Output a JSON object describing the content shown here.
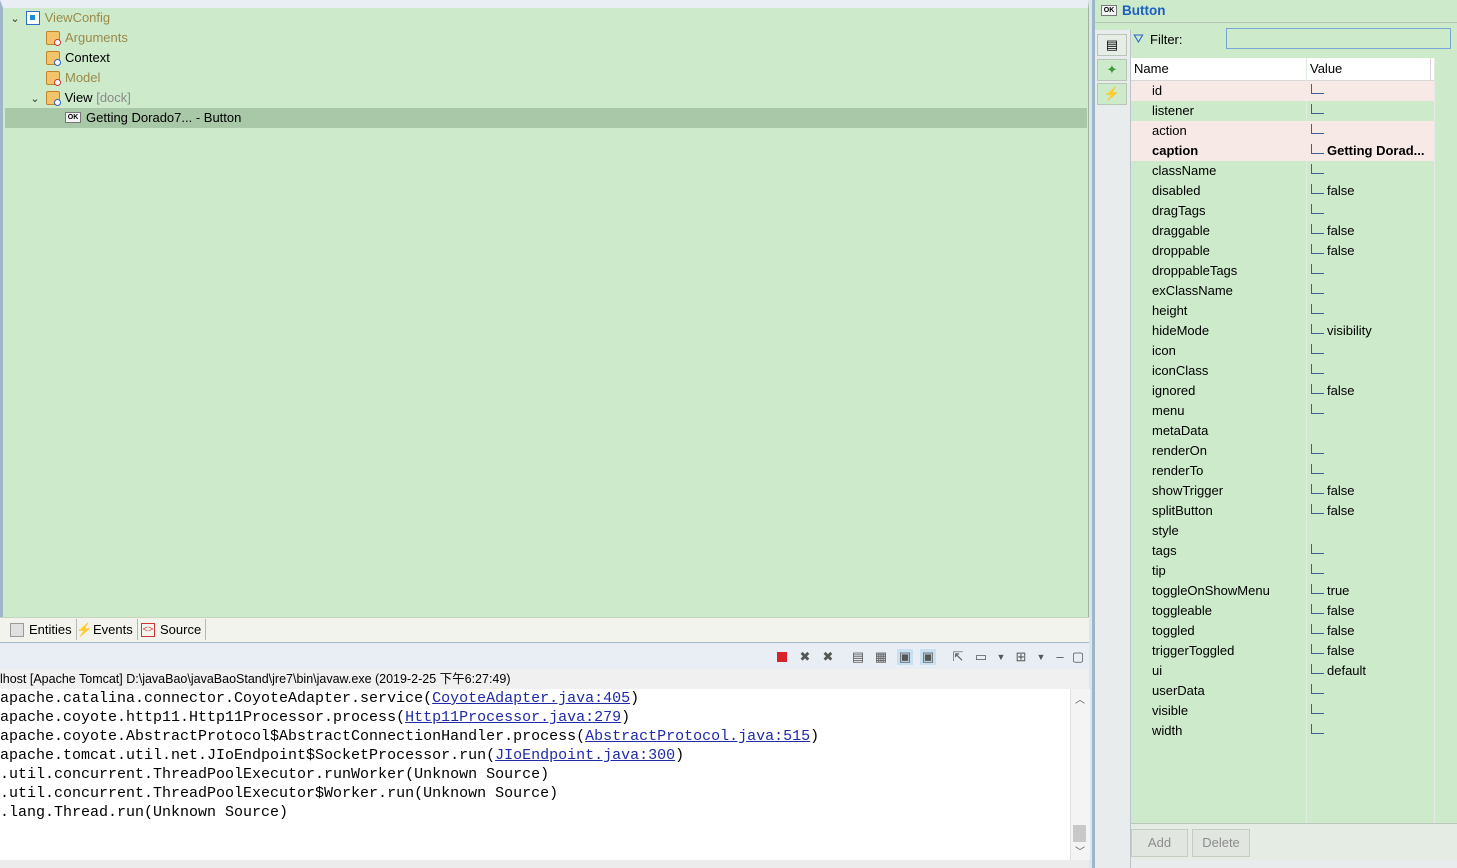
{
  "tree": {
    "items": [
      {
        "label": "ViewConfig",
        "extra": ""
      },
      {
        "label": "Arguments",
        "extra": ""
      },
      {
        "label": "Context",
        "extra": ""
      },
      {
        "label": "Model",
        "extra": ""
      },
      {
        "label": "View",
        "extra": "[dock]"
      },
      {
        "label": "Getting Dorado7... - Button",
        "extra": ""
      }
    ]
  },
  "editor_tabs": [
    "Entities",
    "Events",
    "Source"
  ],
  "console": {
    "header": "lhost [Apache Tomcat] D:\\javaBao\\javaBaoStand\\jre7\\bin\\javaw.exe (2019-2-25 下午6:27:49)",
    "lines": [
      {
        "pre": "apache.catalina.connector.CoyoteAdapter.service(",
        "link": "CoyoteAdapter.java:405",
        "post": ")"
      },
      {
        "pre": "apache.coyote.http11.Http11Processor.process(",
        "link": "Http11Processor.java:279",
        "post": ")"
      },
      {
        "pre": "apache.coyote.AbstractProtocol$AbstractConnectionHandler.process(",
        "link": "AbstractProtocol.java:515",
        "post": ")"
      },
      {
        "pre": "apache.tomcat.util.net.JIoEndpoint$SocketProcessor.run(",
        "link": "JIoEndpoint.java:300",
        "post": ")"
      },
      {
        "pre": ".util.concurrent.ThreadPoolExecutor.runWorker(Unknown Source)",
        "link": "",
        "post": ""
      },
      {
        "pre": ".util.concurrent.ThreadPoolExecutor$Worker.run(Unknown Source)",
        "link": "",
        "post": ""
      },
      {
        "pre": ".lang.Thread.run(Unknown Source)",
        "link": "",
        "post": ""
      }
    ]
  },
  "props": {
    "title": "Button",
    "filter_label": "Filter:",
    "filter_value": "",
    "col_name": "Name",
    "col_value": "Value",
    "add_label": "Add",
    "delete_label": "Delete",
    "rows": [
      {
        "name": "id",
        "value": "",
        "type": "A"
      },
      {
        "name": "listener",
        "value": "",
        "type": "A"
      },
      {
        "name": "action",
        "value": "",
        "type": "1.1"
      },
      {
        "name": "caption",
        "value": "Getting Dorad...",
        "type": "A"
      },
      {
        "name": "className",
        "value": "",
        "type": "A"
      },
      {
        "name": "disabled",
        "value": "false",
        "type": "tf"
      },
      {
        "name": "dragTags",
        "value": "",
        "type": "A"
      },
      {
        "name": "draggable",
        "value": "false",
        "type": "tf"
      },
      {
        "name": "droppable",
        "value": "false",
        "type": "tf"
      },
      {
        "name": "droppableTags",
        "value": "",
        "type": "A"
      },
      {
        "name": "exClassName",
        "value": "",
        "type": "A"
      },
      {
        "name": "height",
        "value": "",
        "type": "1"
      },
      {
        "name": "hideMode",
        "value": "visibility",
        "type": "1.1"
      },
      {
        "name": "icon",
        "value": "",
        "type": "A"
      },
      {
        "name": "iconClass",
        "value": "",
        "type": "A"
      },
      {
        "name": "ignored",
        "value": "false",
        "type": "tf"
      },
      {
        "name": "menu",
        "value": "",
        "type": "1.1"
      },
      {
        "name": "metaData",
        "value": "",
        "type": ""
      },
      {
        "name": "renderOn",
        "value": "",
        "type": "A"
      },
      {
        "name": "renderTo",
        "value": "",
        "type": "A"
      },
      {
        "name": "showTrigger",
        "value": "false",
        "type": "tf"
      },
      {
        "name": "splitButton",
        "value": "false",
        "type": "tf"
      },
      {
        "name": "style",
        "value": "",
        "type": ""
      },
      {
        "name": "tags",
        "value": "",
        "type": "A"
      },
      {
        "name": "tip",
        "value": "",
        "type": "A"
      },
      {
        "name": "toggleOnShowMenu",
        "value": "true",
        "type": "tf"
      },
      {
        "name": "toggleable",
        "value": "false",
        "type": "tf"
      },
      {
        "name": "toggled",
        "value": "false",
        "type": "tf"
      },
      {
        "name": "triggerToggled",
        "value": "false",
        "type": "tf"
      },
      {
        "name": "ui",
        "value": "default",
        "type": "A"
      },
      {
        "name": "userData",
        "value": "",
        "type": "list"
      },
      {
        "name": "visible",
        "value": "",
        "type": "tf"
      },
      {
        "name": "width",
        "value": "",
        "type": "1"
      }
    ]
  },
  "colors": {
    "panel_bg": "#cdeacb",
    "selection": "#a9c8a8",
    "title_blue": "#1d5fc0",
    "link": "#1e2aa8"
  }
}
